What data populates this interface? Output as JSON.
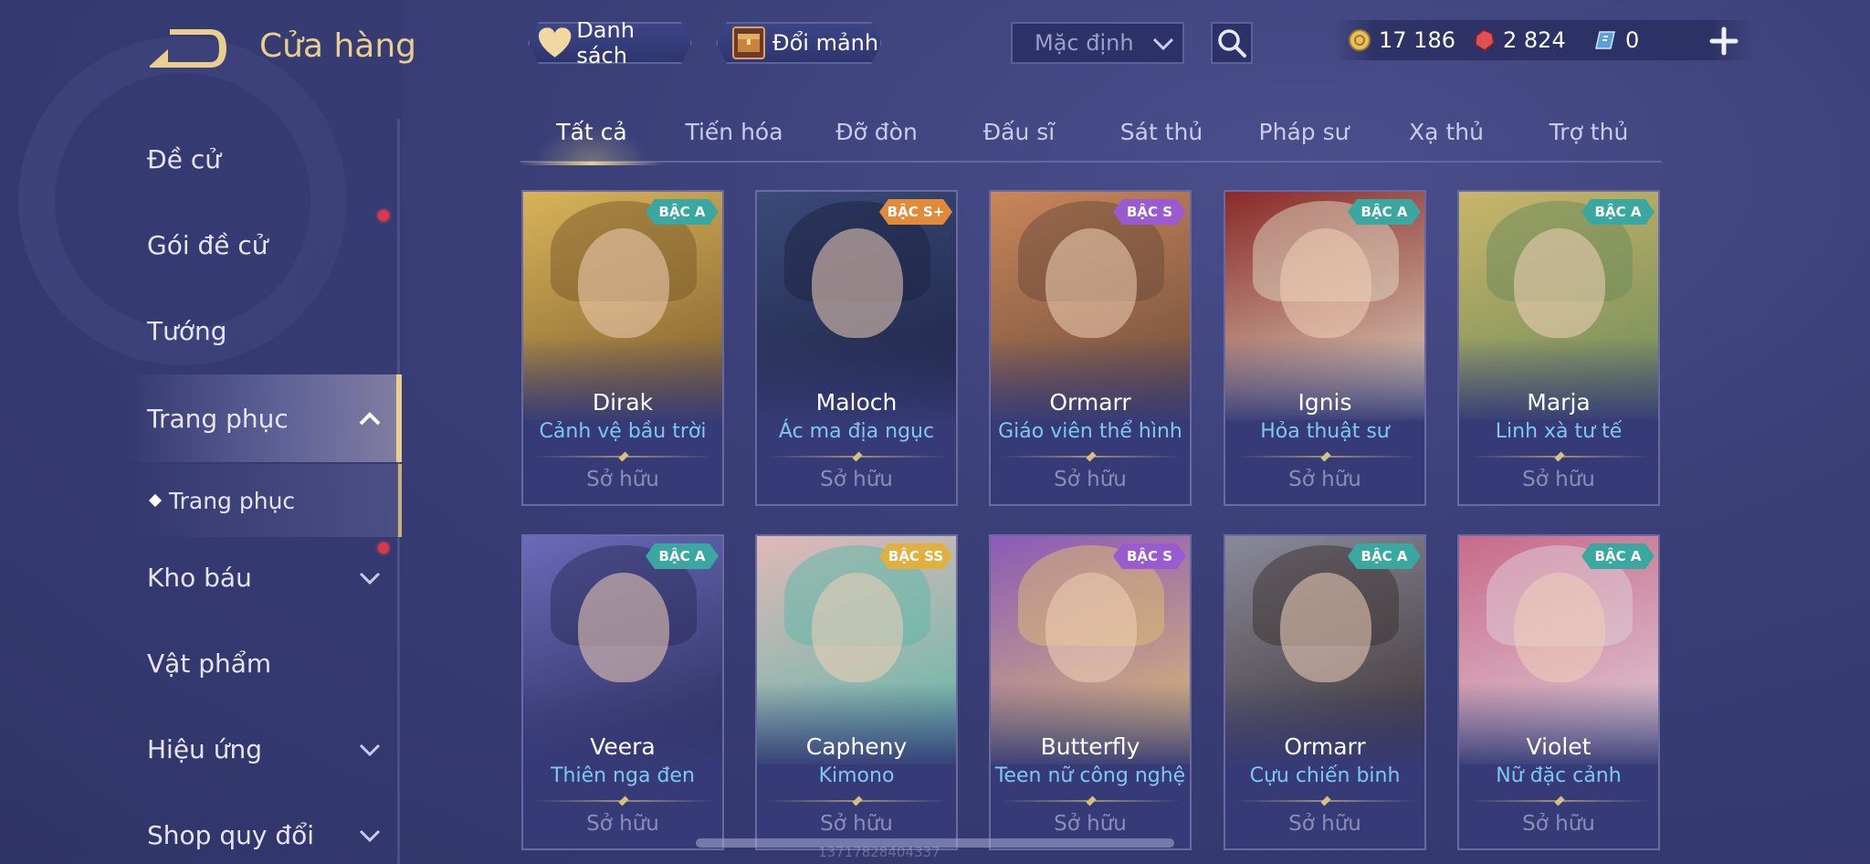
{
  "header": {
    "title": "Cửa hàng",
    "wishlist_label": "Danh sách",
    "exchange_label": "Đổi mảnh",
    "sort_value": "Mặc định",
    "currencies": [
      {
        "icon": "gold-coin-icon",
        "value": "17 186"
      },
      {
        "icon": "ruby-gem-icon",
        "value": "2 824"
      },
      {
        "icon": "voucher-icon",
        "value": "0"
      }
    ]
  },
  "sidebar": {
    "items": [
      {
        "label": "Đề cử"
      },
      {
        "label": "Gói đề cử",
        "has_dot": true
      },
      {
        "label": "Tướng"
      },
      {
        "label": "Trang phục",
        "expanded": true,
        "active": true
      },
      {
        "label": "Trang phục",
        "sub": true
      },
      {
        "label": "Kho báu",
        "has_dot": true,
        "chevron": true
      },
      {
        "label": "Vật phẩm"
      },
      {
        "label": "Hiệu ứng",
        "chevron": true
      },
      {
        "label": "Shop quy đổi",
        "chevron": true
      }
    ]
  },
  "tabs": [
    "Tất cả",
    "Tiến hóa",
    "Đỡ đòn",
    "Đấu sĩ",
    "Sát thủ",
    "Pháp sư",
    "Xạ thủ",
    "Trợ thủ"
  ],
  "active_tab": "Tất cả",
  "cards": [
    {
      "hero": "Dirak",
      "skin": "Cảnh vệ bầu trời",
      "rank": "BẬC A",
      "status": "Sở hữu",
      "palette": [
        "#d9b35a",
        "#7a5a2a"
      ]
    },
    {
      "hero": "Maloch",
      "skin": "Ác ma địa ngục",
      "rank": "BẬC S+",
      "status": "Sở hữu",
      "palette": [
        "#3a4a7a",
        "#1c2240"
      ]
    },
    {
      "hero": "Ormarr",
      "skin": "Giáo viên thể hình",
      "rank": "BẬC S",
      "status": "Sở hữu",
      "palette": [
        "#c9865a",
        "#6a4a3a"
      ]
    },
    {
      "hero": "Ignis",
      "skin": "Hỏa thuật sư",
      "rank": "BẬC A",
      "status": "Sở hữu",
      "palette": [
        "#8a2a2a",
        "#e0d8c0"
      ]
    },
    {
      "hero": "Marja",
      "skin": "Linh xà tư tế",
      "rank": "BẬC A",
      "status": "Sở hữu",
      "palette": [
        "#c9b56a",
        "#6a8a5a"
      ]
    },
    {
      "hero": "Veera",
      "skin": "Thiên nga đen",
      "rank": "BẬC A",
      "status": "Sở hữu",
      "palette": [
        "#6a6ab8",
        "#2a2a5a"
      ]
    },
    {
      "hero": "Capheny",
      "skin": "Kimono",
      "rank": "BẬC SS",
      "status": "Sở hữu",
      "palette": [
        "#e0b8b8",
        "#5ab8a8"
      ]
    },
    {
      "hero": "Butterfly",
      "skin": "Teen nữ công nghệ",
      "rank": "BẬC S",
      "status": "Sở hữu",
      "palette": [
        "#8a5ab8",
        "#e0c070"
      ]
    },
    {
      "hero": "Ormarr",
      "skin": "Cựu chiến binh",
      "rank": "BẬC A",
      "status": "Sở hữu",
      "palette": [
        "#8a8a9a",
        "#3a3030"
      ]
    },
    {
      "hero": "Violet",
      "skin": "Nữ đặc cảnh",
      "rank": "BẬC A",
      "status": "Sở hữu",
      "palette": [
        "#c86a8a",
        "#e0d0d8"
      ]
    }
  ],
  "rank_colors": {
    "BẬC A": "#3aa8a0",
    "BẬC S": "#9a5ad0",
    "BẬC S+": "#e08a3a",
    "BẬC SS": "#e0b040"
  },
  "watermark": "13717828404337"
}
